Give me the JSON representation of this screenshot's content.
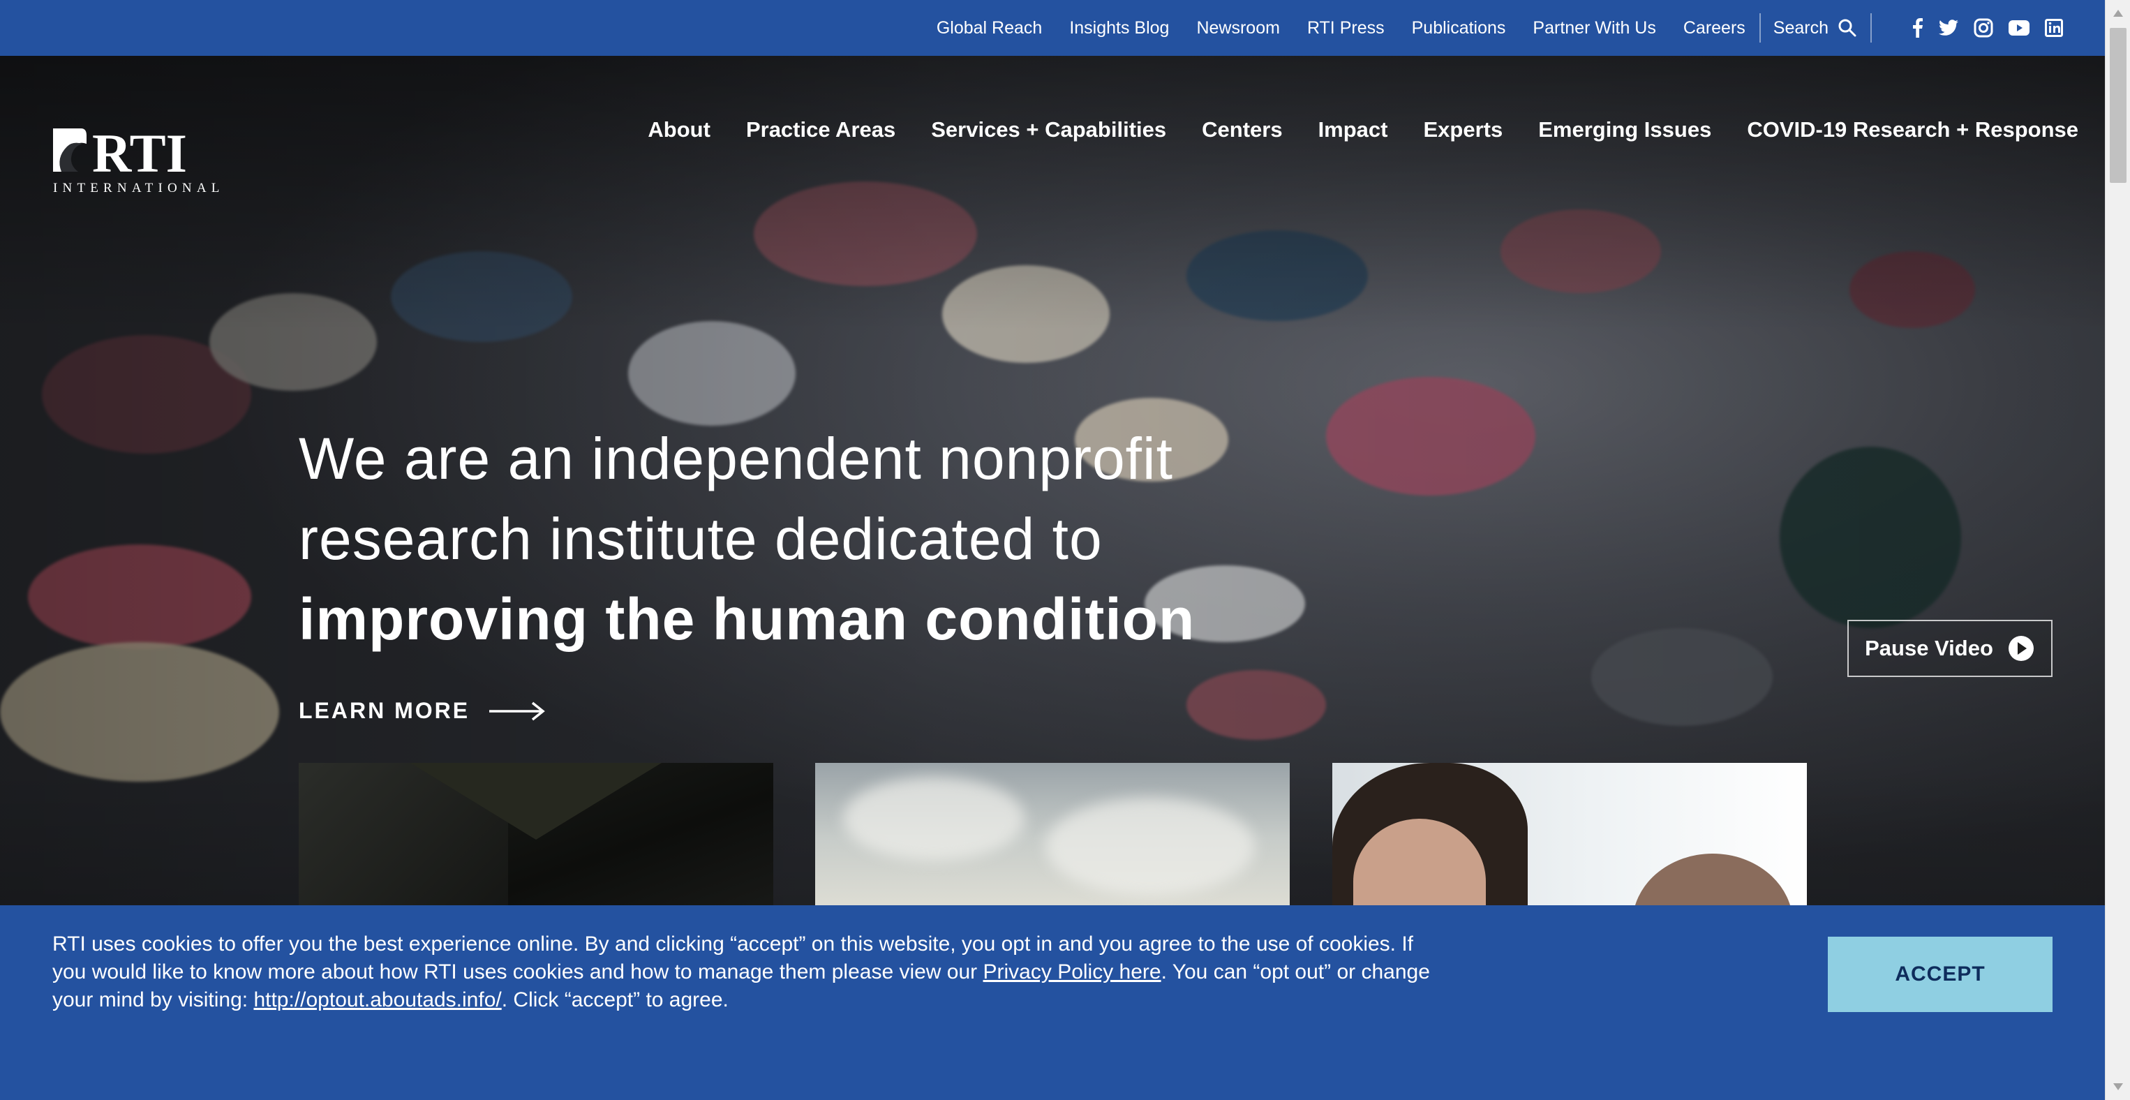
{
  "utility_nav": {
    "links": [
      "Global Reach",
      "Insights Blog",
      "Newsroom",
      "RTI Press",
      "Publications",
      "Partner With Us",
      "Careers"
    ],
    "search_label": "Search",
    "social_icons": [
      "facebook-icon",
      "twitter-icon",
      "instagram-icon",
      "youtube-icon",
      "linkedin-icon"
    ]
  },
  "logo": {
    "text": "RTI",
    "subtext": "INTERNATIONAL"
  },
  "main_nav": {
    "items": [
      "About",
      "Practice Areas",
      "Services + Capabilities",
      "Centers",
      "Impact",
      "Experts",
      "Emerging Issues",
      "COVID-19 Research + Response"
    ]
  },
  "hero": {
    "line1": "We are an independent nonprofit",
    "line2": "research institute dedicated to",
    "line3": "improving the human condition",
    "learn_more": "LEARN MORE",
    "pause_video": "Pause Video"
  },
  "cookie_banner": {
    "text_part1": "RTI uses cookies to offer you the best experience online. By and clicking “accept” on this website, you opt in and you agree to the use of cookies. If you would like to know more about how RTI uses cookies and how to manage them please view our ",
    "privacy_link": "Privacy Policy here",
    "text_part2": ". You can “opt out” or change your mind by visiting: ",
    "optout_link": "http://optout.aboutads.info/",
    "text_part3": ". Click “accept” to agree.",
    "accept_label": "ACCEPT"
  },
  "colors": {
    "brand_blue": "#2452a0",
    "accept_button": "#8fcfe2"
  }
}
